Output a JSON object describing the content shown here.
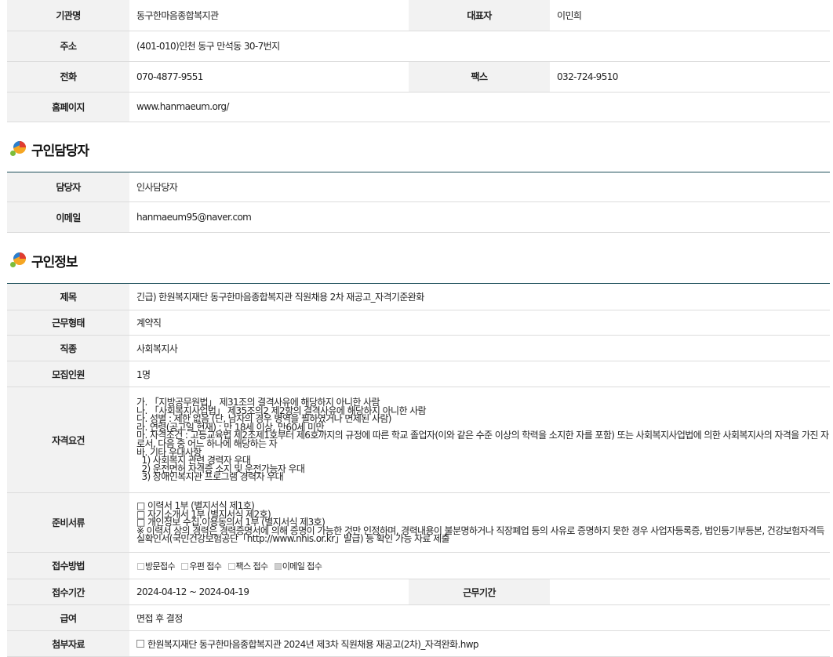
{
  "org": {
    "name_label": "기관명",
    "name": "동구한마음종합복지관",
    "rep_label": "대표자",
    "rep": "이민희",
    "addr_label": "주소",
    "addr": "(401-010)인천 동구 만석동 30-7번지",
    "tel_label": "전화",
    "tel": "070-4877-9551",
    "fax_label": "팩스",
    "fax": "032-724-9510",
    "home_label": "홈페이지",
    "home": "www.hanmaeum.org/"
  },
  "contact_section": {
    "title": "구인담당자",
    "person_label": "담당자",
    "person": "인사담당자",
    "email_label": "이메일",
    "email": "hanmaeum95@naver.com"
  },
  "job_section": {
    "title": "구인정보",
    "subject_label": "제목",
    "subject": "긴급) 한원복지재단 동구한마음종합복지관 직원채용 2차 재공고_자격기준완화",
    "worktype_label": "근무형태",
    "worktype": "계약직",
    "jobtype_label": "직종",
    "jobtype": "사회복지사",
    "headcount_label": "모집인원",
    "headcount": "1명",
    "quals_label": "자격요건",
    "quals": [
      "가. 「지방공무원법」 제31조의 결격사유에 해당하지 아니한 사람",
      "나. 「사회복지사업법」 제35조의2 제2항의 결격사유에 해당하지 아니한 사람",
      "다. 성별 : 제한 없음 (단, 남자의 경우 병역을 필하였거나 면제된 사람)",
      "라. 연령(공고일 현재) : 만 18세 이상, 만60세 미만",
      "마. 자격조건 : 고등교육법 제2조제1호부터 제6호까지의 규정에 따른 학교 졸업자(이와 같은 수준 이상의 학력을 소지한 자를 포함) 또는 사회복지사업법에 의한 사회복지사의 자격을 가진 자",
      "로서, 다음 중 어느 하나에 해당하는 자",
      "바. 기타 우대사항",
      "  1) 사회복지 관련 경력자 우대",
      "  2) 운전면허 자격증 소지 및 운전가능자 우대",
      "  3) 장애인복지관 프로그램 경력자 우대"
    ],
    "docs_label": "준비서류",
    "docs": [
      "□ 이력서 1부 (별지서식 제1호)",
      "□ 자기소개서 1부 (별지서식 제2호)",
      "□ 개인정보 수집.이용동의서 1부 (별지서식 제3호)",
      "※ 이력서 상의 경력은 경력증명서에 의해 증명이 가능한 것만 인정하며, 경력내용이 불분명하거나 직장폐업 등의 사유로 증명하지 못한 경우 사업자등록증, 법인등기부등본, 건강보험자격득",
      "실확인서(국민건강보험공단「http://www.nhis.or.kr」발급) 등 확인 가능 자료 제출"
    ],
    "method_label": "접수방법",
    "methods": [
      {
        "label": "방문접수",
        "checked": false
      },
      {
        "label": "우편 접수",
        "checked": false
      },
      {
        "label": "팩스 접수",
        "checked": false
      },
      {
        "label": "이메일 접수",
        "checked": true
      }
    ],
    "period_label": "접수기간",
    "period": "2024-04-12 ~ 2024-04-19",
    "workperiod_label": "근무기간",
    "workperiod": "",
    "salary_label": "급여",
    "salary": "면접 후 결정",
    "attach_label": "첨부자료",
    "attach": "한원복지재단 동구한마음종합복지관 2024년 제3차 직원채용 재공고(2차)_자격완화.hwp"
  }
}
